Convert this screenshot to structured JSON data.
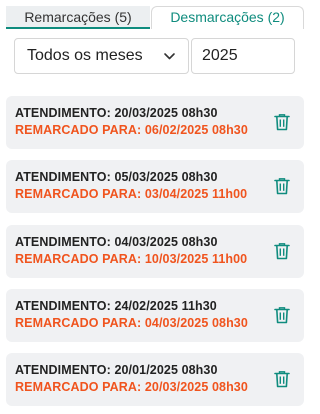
{
  "tabs": [
    {
      "label": "Remarcações (5)",
      "active": true
    },
    {
      "label": "Desmarcações (2)",
      "active": false
    }
  ],
  "filters": {
    "month": "Todos os meses",
    "year": "2025"
  },
  "cards": [
    {
      "attendance": "ATENDIMENTO: 20/03/2025 08h30",
      "rescheduled": "REMARCADO PARA: 06/02/2025 08h30"
    },
    {
      "attendance": "ATENDIMENTO: 05/03/2025 08h30",
      "rescheduled": "REMARCADO PARA: 03/04/2025 11h00"
    },
    {
      "attendance": "ATENDIMENTO: 04/03/2025 08h30",
      "rescheduled": "REMARCADO PARA: 10/03/2025 11h00"
    },
    {
      "attendance": "ATENDIMENTO: 24/02/2025 11h30",
      "rescheduled": "REMARCADO PARA: 04/03/2025 08h30"
    },
    {
      "attendance": "ATENDIMENTO: 20/01/2025 08h30",
      "rescheduled": "REMARCADO PARA: 20/03/2025 08h30"
    }
  ],
  "icons": {
    "delete": "trash-icon",
    "dropdown": "chevron-down-icon"
  },
  "colors": {
    "accent": "#0f8c7e",
    "rescheduled_text": "#f0541e",
    "card_bg": "#f0f1f3"
  }
}
